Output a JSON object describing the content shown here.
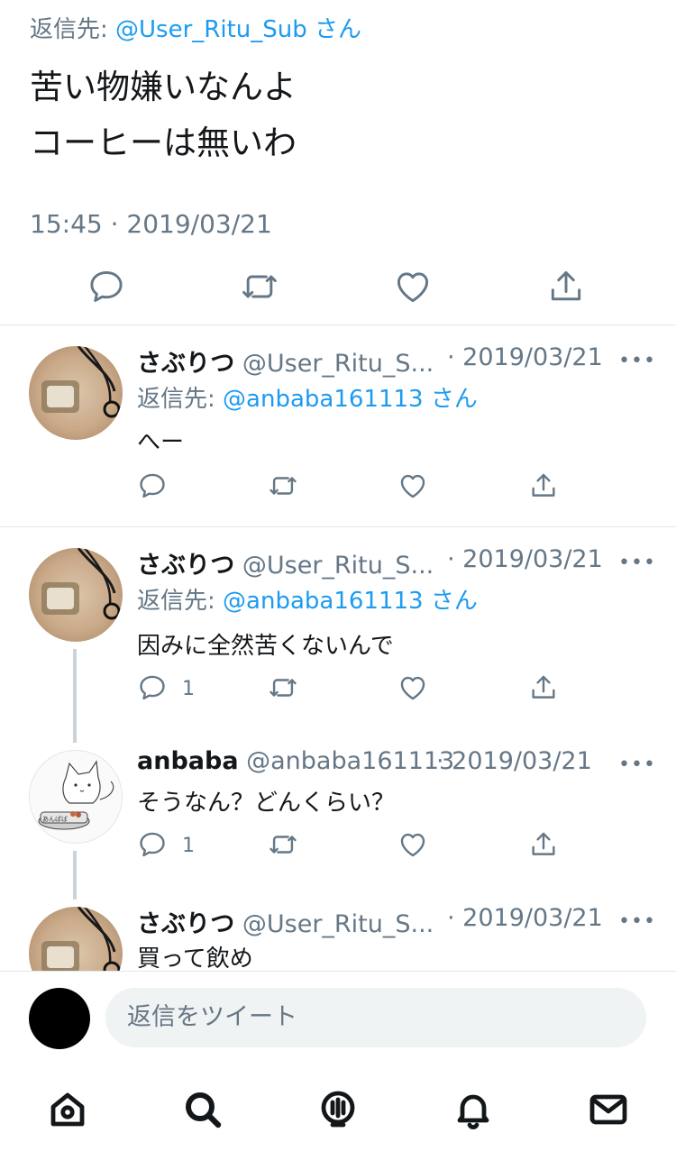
{
  "main_tweet": {
    "reply_prefix": "返信先:",
    "reply_handle": "@User_Ritu_Sub",
    "reply_suffix": "さん",
    "lines": [
      "苦い物嫌いなんよ",
      "コーヒーは無いわ"
    ],
    "timestamp": "15:45 · 2019/03/21",
    "actions": [
      "reply-icon",
      "retweet-icon",
      "like-icon",
      "share-icon"
    ]
  },
  "replies": [
    {
      "name": "さぶりつ",
      "handle": "@User_Ritu_S...",
      "date": "· 2019/03/21",
      "more": "•••",
      "reply_prefix": "返信先:",
      "reply_handle": "@anbaba161113",
      "reply_suffix": "さん",
      "text": "へー",
      "reply_count": ""
    },
    {
      "name": "さぶりつ",
      "handle": "@User_Ritu_S...",
      "date": "· 2019/03/21",
      "more": "•••",
      "reply_prefix": "返信先:",
      "reply_handle": "@anbaba161113",
      "reply_suffix": "さん",
      "text": "因みに全然苦くないんで",
      "reply_count": "1"
    },
    {
      "name": "anbaba",
      "handle": "@anbaba161113",
      "date": "· 2019/03/21",
      "more": "•••",
      "text": "そうなん？どんくらい？",
      "reply_count": "1",
      "avatar_text": "あんぱば"
    },
    {
      "name": "さぶりつ",
      "handle": "@User_Ritu_S...",
      "date": "· 2019/03/21",
      "more": "•••",
      "text": "買って飲め"
    }
  ],
  "composer": {
    "placeholder": "返信をツイート"
  },
  "tabbar": [
    "home-icon",
    "search-icon",
    "spaces-icon",
    "notifications-icon",
    "messages-icon"
  ],
  "colors": {
    "link": "#1d9bf0",
    "secondary_text": "#657786",
    "divider": "#e1e8ed"
  }
}
